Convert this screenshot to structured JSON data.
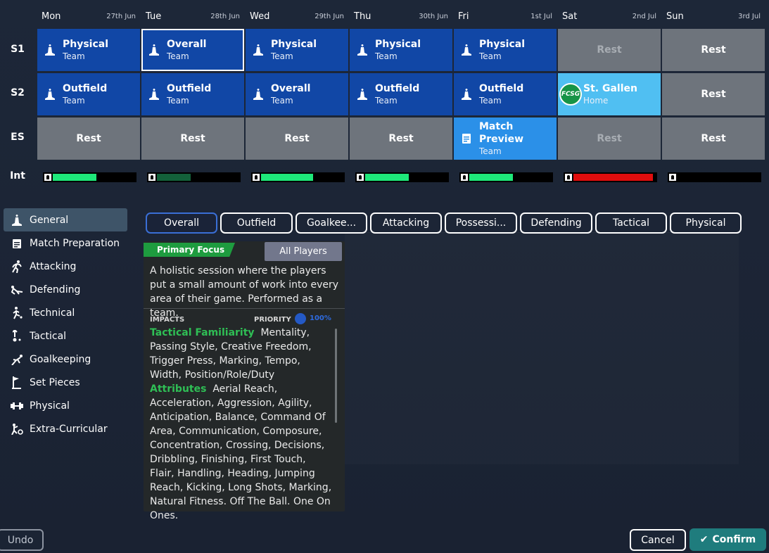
{
  "days": [
    {
      "name": "Mon",
      "date": "27th Jun"
    },
    {
      "name": "Tue",
      "date": "28th Jun"
    },
    {
      "name": "Wed",
      "date": "29th Jun"
    },
    {
      "name": "Thu",
      "date": "30th Jun"
    },
    {
      "name": "Fri",
      "date": "1st Jul"
    },
    {
      "name": "Sat",
      "date": "2nd Jul"
    },
    {
      "name": "Sun",
      "date": "3rd Jul"
    }
  ],
  "row_labels": {
    "s1": "S1",
    "s2": "S2",
    "es": "ES",
    "int": "Int"
  },
  "sessions": {
    "s1": [
      {
        "main": "Physical",
        "sub": "Team"
      },
      {
        "main": "Overall",
        "sub": "Team"
      },
      {
        "main": "Physical",
        "sub": "Team"
      },
      {
        "main": "Physical",
        "sub": "Team"
      },
      {
        "main": "Physical",
        "sub": "Team"
      },
      {
        "main": "Rest"
      },
      {
        "main": "Rest"
      }
    ],
    "s2": [
      {
        "main": "Outfield",
        "sub": "Team"
      },
      {
        "main": "Outfield",
        "sub": "Team"
      },
      {
        "main": "Overall",
        "sub": "Team"
      },
      {
        "main": "Outfield",
        "sub": "Team"
      },
      {
        "main": "Outfield",
        "sub": "Team"
      },
      {
        "main": "St. Gallen",
        "sub": "Home",
        "badge": "FCSG"
      },
      {
        "main": "Rest"
      }
    ],
    "es": [
      {
        "main": "Rest"
      },
      {
        "main": "Rest"
      },
      {
        "main": "Rest"
      },
      {
        "main": "Rest"
      },
      {
        "main": "Match Preview",
        "main_line1": "Match",
        "main_line2": "Preview",
        "sub": "Team"
      },
      {
        "main": "Rest"
      },
      {
        "main": "Rest"
      }
    ]
  },
  "intensity": [
    {
      "level": 0.52,
      "color": "#1ee87a"
    },
    {
      "level": 0.4,
      "color": "#13613a"
    },
    {
      "level": 0.62,
      "color": "#1ee87a"
    },
    {
      "level": 0.52,
      "color": "#1ee87a"
    },
    {
      "level": 0.52,
      "color": "#1ee87a"
    },
    {
      "level": 0.95,
      "color": "#e00d0d"
    },
    {
      "level": 0.0,
      "color": "#000000"
    }
  ],
  "sidebar": {
    "items": [
      {
        "label": "General",
        "icon": "general-icon"
      },
      {
        "label": "Match Preparation",
        "icon": "clipboard-icon"
      },
      {
        "label": "Attacking",
        "icon": "running-icon"
      },
      {
        "label": "Defending",
        "icon": "tackle-icon"
      },
      {
        "label": "Technical",
        "icon": "kick-icon"
      },
      {
        "label": "Tactical",
        "icon": "tactics-icon"
      },
      {
        "label": "Goalkeeping",
        "icon": "keeper-icon"
      },
      {
        "label": "Set Pieces",
        "icon": "corner-flag-icon"
      },
      {
        "label": "Physical",
        "icon": "dumbbell-icon"
      },
      {
        "label": "Extra-Curricular",
        "icon": "extra-icon"
      }
    ]
  },
  "tabs": [
    "Overall",
    "Outfield",
    "Goalkee...",
    "Attacking",
    "Possessi...",
    "Defending",
    "Tactical",
    "Physical"
  ],
  "panel": {
    "focus_label": "Primary Focus",
    "players_button": "All Players",
    "description": "A holistic session where the players put a small amount of work into every area of their game. Performed as a team.",
    "impacts_label": "IMPACTS",
    "priority_label": "PRIORITY",
    "priority_value": "100%",
    "tactical_heading": "Tactical Familiarity",
    "tactical_text": "Mentality, Passing Style, Creative Freedom, Trigger Press, Marking, Tempo, Width, Position/Role/Duty",
    "attributes_heading": "Attributes",
    "attributes_text": "Aerial Reach, Acceleration, Aggression, Agility, Anticipation, Balance, Command Of Area, Communication, Composure, Concentration, Crossing, Decisions, Dribbling, Finishing, First Touch, Flair, Handling, Heading, Jumping Reach, Kicking, Long Shots, Marking, Natural Fitness. Off The Ball. One On Ones."
  },
  "buttons": {
    "undo": "Undo",
    "cancel": "Cancel",
    "confirm": "Confirm"
  }
}
